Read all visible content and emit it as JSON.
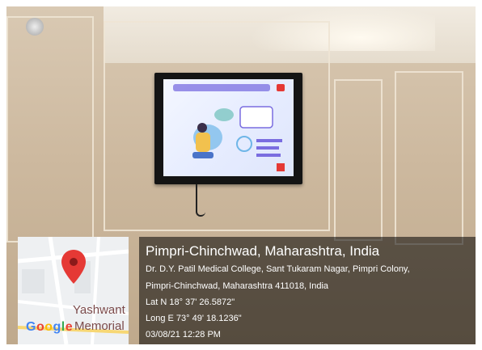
{
  "overlay": {
    "place": "Pimpri-Chinchwad, Maharashtra, India",
    "address_line1": "Dr. D.Y. Patil Medical College, Sant Tukaram Nagar, Pimpri Colony,",
    "address_line2": "Pimpri-Chinchwad, Maharashtra 411018, India",
    "lat": "Lat N 18° 37' 26.5872\"",
    "long": "Long E 73° 49' 18.1236\"",
    "datetime": "03/08/21 12:28 PM"
  },
  "map": {
    "label1": "Yashwant",
    "label2": "Memorial",
    "brand": "Google",
    "pin_icon": "map-pin-icon",
    "pin_color": "#e53935"
  },
  "colors": {
    "wall": "#cdb99f",
    "tv_bezel": "#141414",
    "screen_accent": "#e53935"
  }
}
